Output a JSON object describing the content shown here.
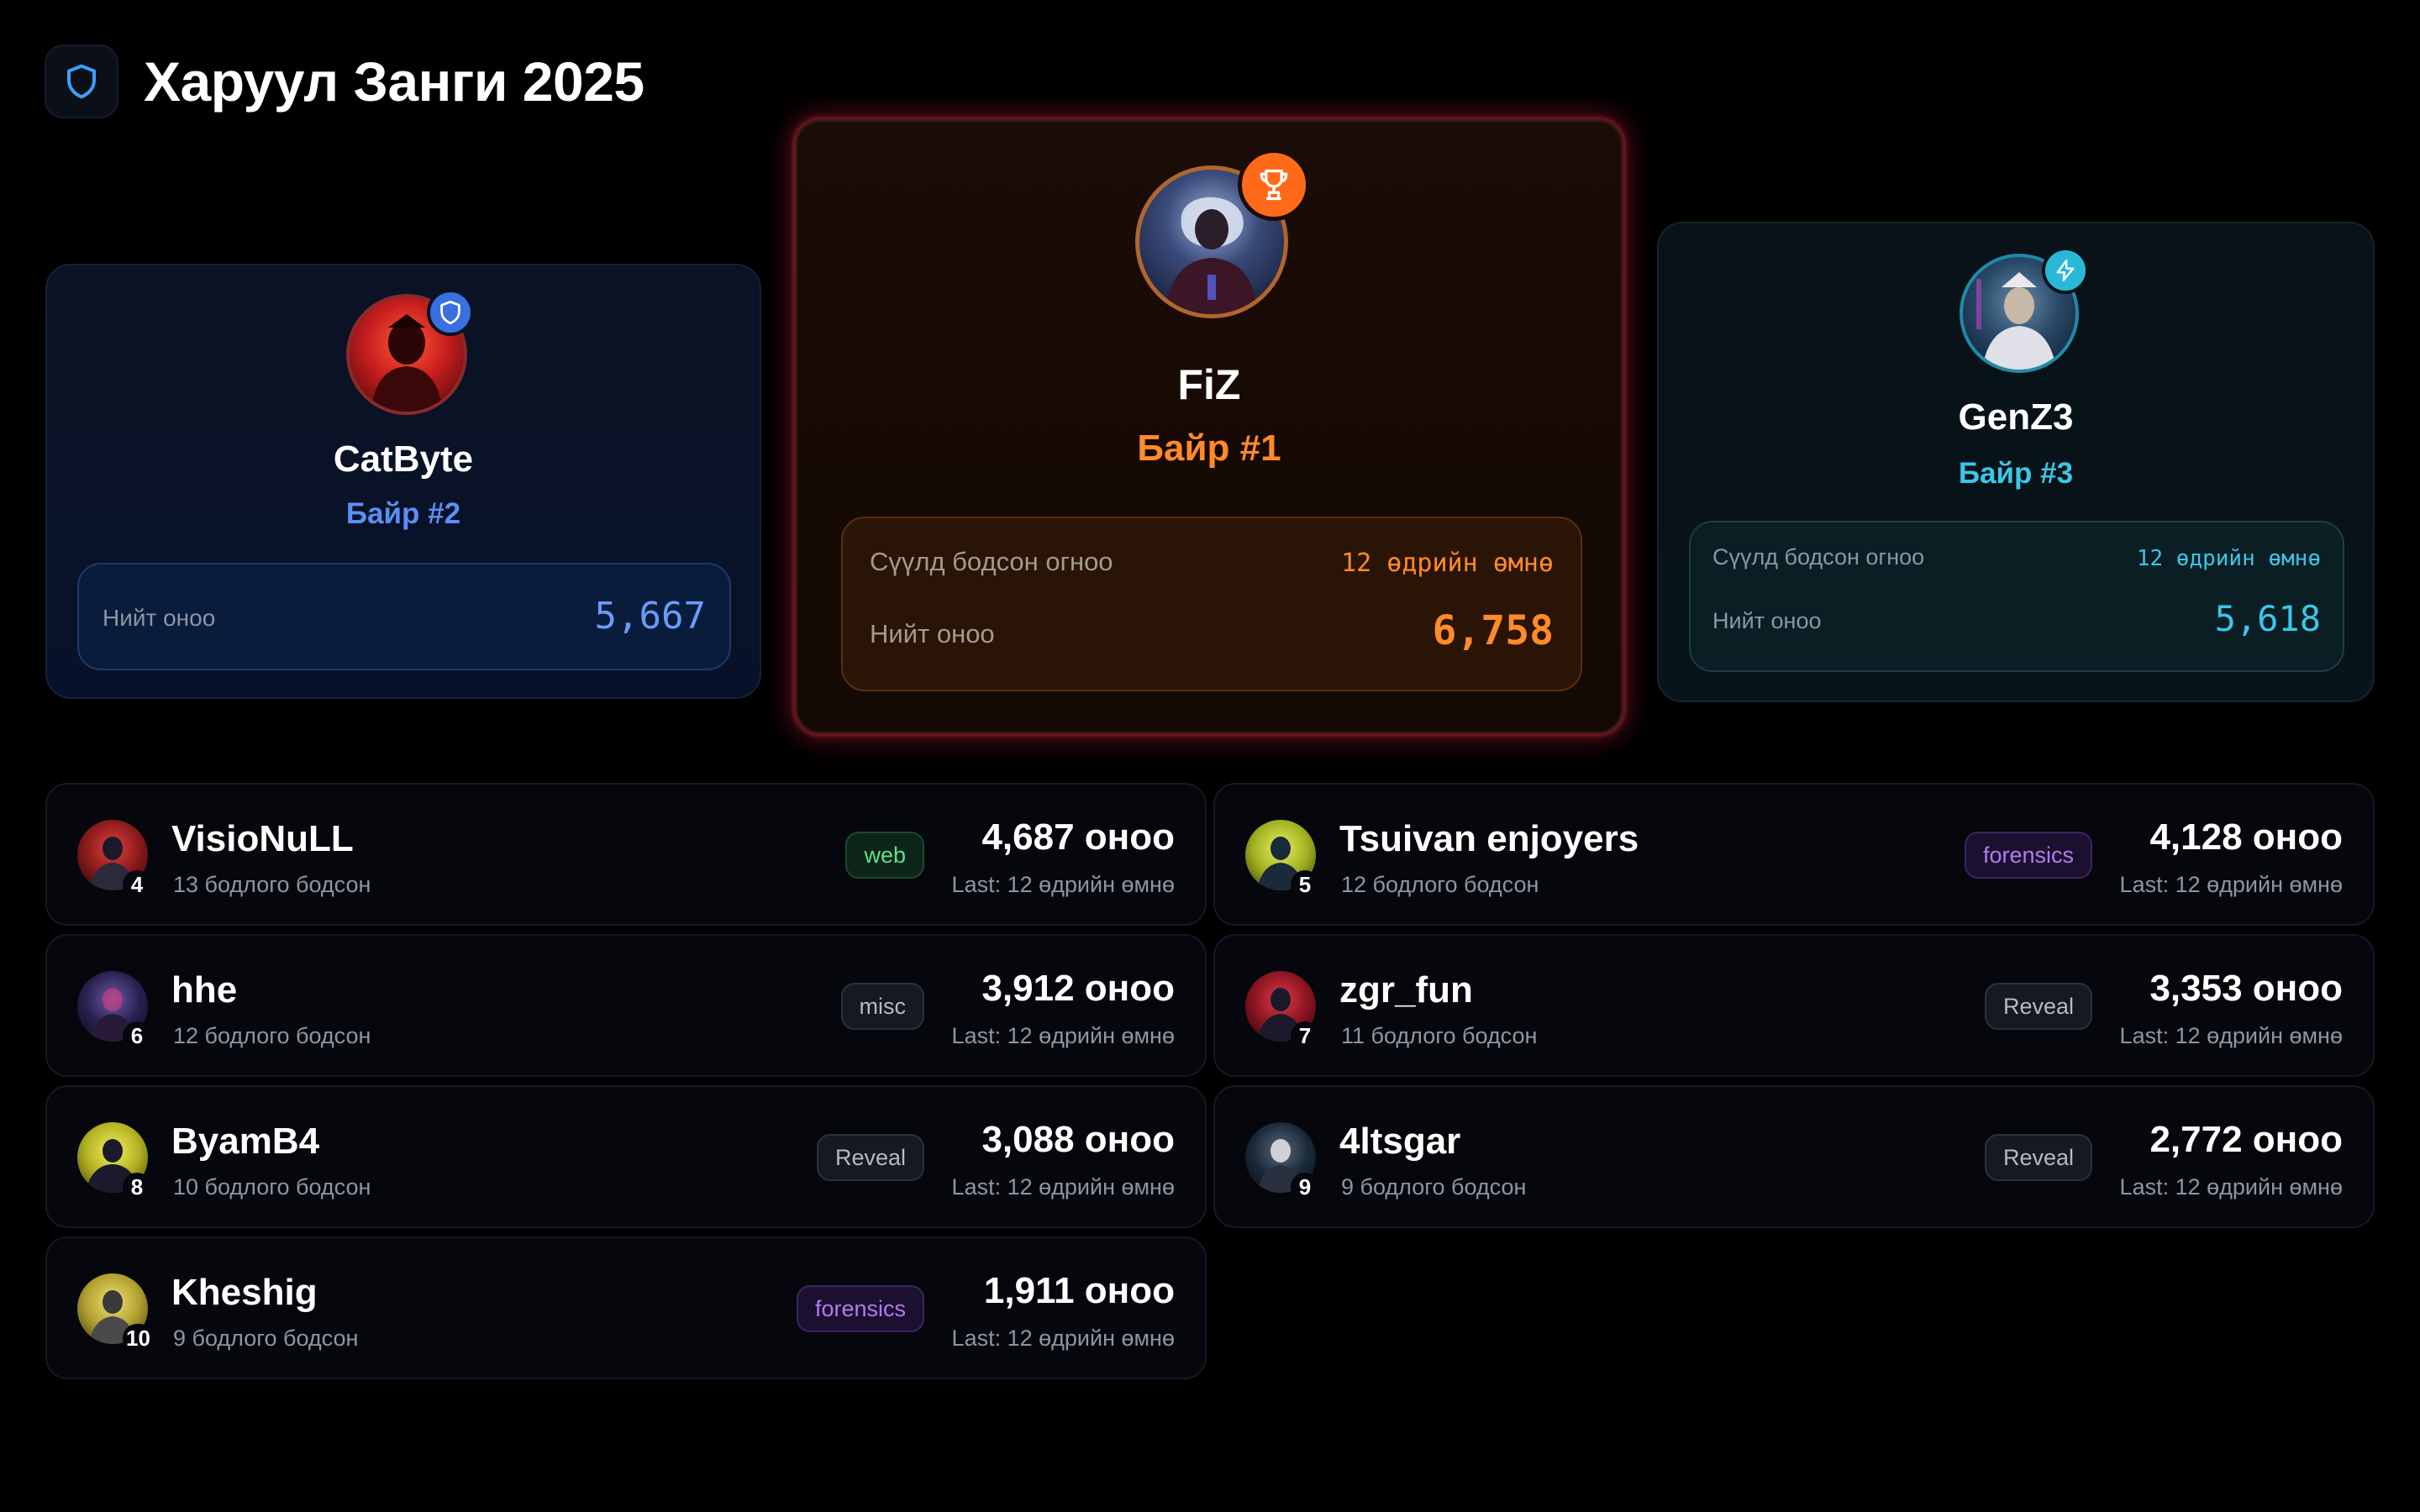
{
  "header": {
    "title": "Харуул Занги 2025",
    "logo_icon": "shield-icon",
    "accent": "#3aa0ff"
  },
  "podium": {
    "first": {
      "name": "FiZ",
      "rank_label": "Байр #1",
      "badge_icon": "trophy-icon",
      "last_solve_label": "Сүүлд бодсон огноо",
      "last_solve_value": "12 өдрийн өмнө",
      "total_label": "Нийт оноо",
      "total_value": "6,758",
      "accent": "#ff8a2a"
    },
    "second": {
      "name": "CatByte",
      "rank_label": "Байр #2",
      "badge_icon": "shield-icon",
      "total_label": "Нийт оноо",
      "total_value": "5,667",
      "accent": "#5b8ef5"
    },
    "third": {
      "name": "GenZ3",
      "rank_label": "Байр #3",
      "badge_icon": "lightning-icon",
      "last_solve_label": "Сүүлд бодсон огноо",
      "last_solve_value": "12 өдрийн өмнө",
      "total_label": "Нийт оноо",
      "total_value": "5,618",
      "accent": "#3cc6e8"
    }
  },
  "rows": [
    {
      "rank": "4",
      "team": "VisioNuLL",
      "solved": "13 бодлого бодсон",
      "tag": "web",
      "score": "4,687 оноо",
      "last": "Last: 12 өдрийн өмнө"
    },
    {
      "rank": "5",
      "team": "Tsuivan enjoyers",
      "solved": "12 бодлого бодсон",
      "tag": "forensics",
      "score": "4,128 оноо",
      "last": "Last: 12 өдрийн өмнө"
    },
    {
      "rank": "6",
      "team": "hhe",
      "solved": "12 бодлого бодсон",
      "tag": "misc",
      "score": "3,912 оноо",
      "last": "Last: 12 өдрийн өмнө"
    },
    {
      "rank": "7",
      "team": "zgr_fun",
      "solved": "11 бодлого бодсон",
      "tag": "Reveal",
      "score": "3,353 оноо",
      "last": "Last: 12 өдрийн өмнө"
    },
    {
      "rank": "8",
      "team": "ByamB4",
      "solved": "10 бодлого бодсон",
      "tag": "Reveal",
      "score": "3,088 оноо",
      "last": "Last: 12 өдрийн өмнө"
    },
    {
      "rank": "9",
      "team": "4ltsgar",
      "solved": "9 бодлого бодсон",
      "tag": "Reveal",
      "score": "2,772 оноо",
      "last": "Last: 12 өдрийн өмнө"
    },
    {
      "rank": "10",
      "team": "Kheshig",
      "solved": "9 бодлого бодсон",
      "tag": "forensics",
      "score": "1,911 оноо",
      "last": "Last: 12 өдрийн өмнө"
    }
  ]
}
